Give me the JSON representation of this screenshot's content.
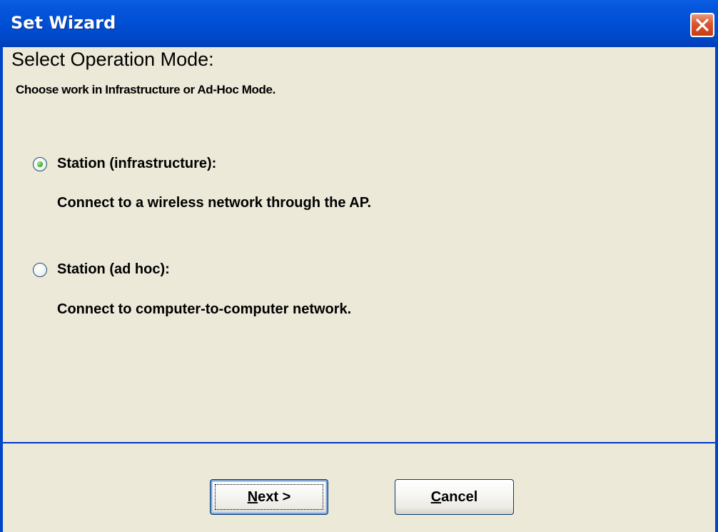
{
  "window": {
    "title": "Set Wizard"
  },
  "content": {
    "heading": "Select Operation Mode:",
    "subheading": "Choose work in Infrastructure or Ad-Hoc Mode."
  },
  "options": [
    {
      "label": "Station (infrastructure):",
      "description": "Connect to a wireless network through the AP.",
      "selected": true
    },
    {
      "label": "Station (ad hoc):",
      "description": "Connect to computer-to-computer network.",
      "selected": false
    }
  ],
  "buttons": {
    "next": {
      "accel": "N",
      "rest": "ext >"
    },
    "cancel": {
      "accel": "C",
      "rest": "ancel"
    }
  },
  "colors": {
    "titlebar": "#0054E3",
    "dialog_bg": "#ECE9D8",
    "separator": "#0033CC",
    "radio_selected": "#21A121"
  },
  "icons": {
    "close": "close-icon"
  }
}
